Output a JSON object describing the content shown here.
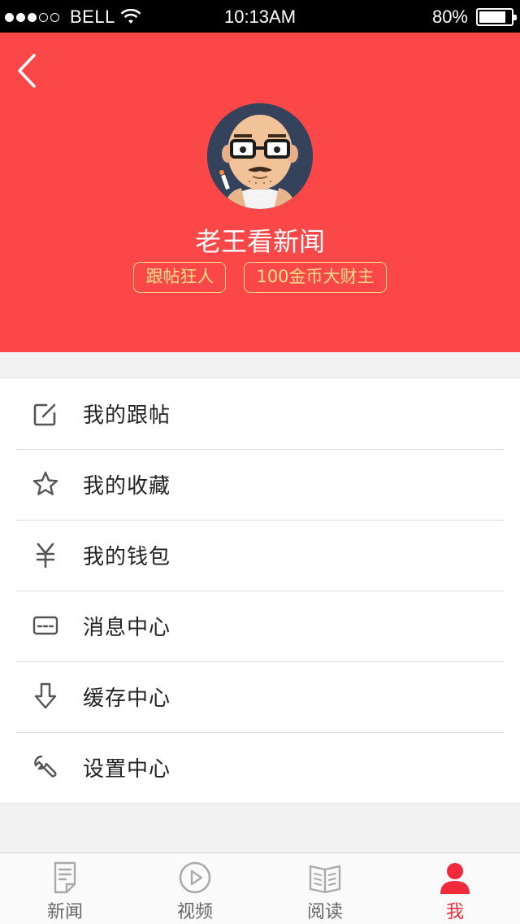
{
  "status_bar": {
    "carrier": "BELL",
    "time": "10:13AM",
    "battery": "80%",
    "signal_dots_filled": 3,
    "signal_dots_total": 5
  },
  "profile": {
    "username": "老王看新闻",
    "badges": [
      "跟帖狂人",
      "100金币大财主"
    ],
    "header_color": "#fb4747",
    "badge_color": "#ffe08a"
  },
  "menu": [
    {
      "label": "我的跟帖",
      "icon": "edit-icon"
    },
    {
      "label": "我的收藏",
      "icon": "star-icon"
    },
    {
      "label": "我的钱包",
      "icon": "yen-icon"
    },
    {
      "label": "消息中心",
      "icon": "message-icon"
    },
    {
      "label": "缓存中心",
      "icon": "download-icon"
    },
    {
      "label": "设置中心",
      "icon": "wrench-icon"
    }
  ],
  "tabbar": {
    "active_color": "#f02a3a",
    "tabs": [
      {
        "label": "新闻",
        "icon": "news-icon"
      },
      {
        "label": "视频",
        "icon": "video-icon"
      },
      {
        "label": "阅读",
        "icon": "book-icon"
      },
      {
        "label": "我",
        "icon": "person-icon",
        "active": true
      }
    ]
  }
}
